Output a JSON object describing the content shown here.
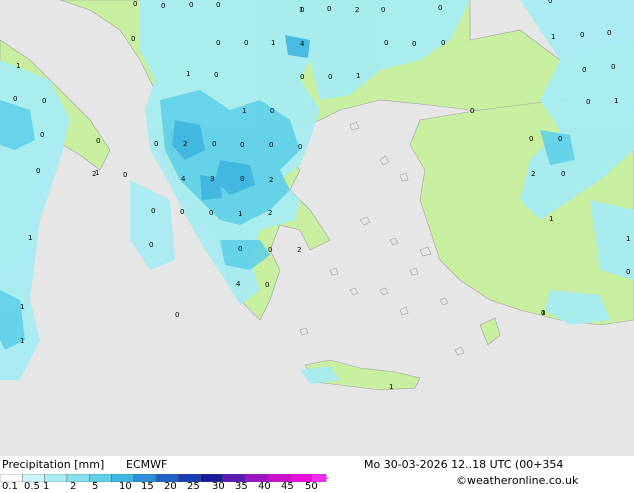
{
  "title": "Precipitation [mm]",
  "model": "ECMWF",
  "valid_time": "Mo 30-03-2026 12..18 UTC (00+354",
  "credit": "©weatheronline.co.uk",
  "legend": {
    "labels": [
      "0.1",
      "0.5",
      "1",
      "2",
      "5",
      "10",
      "15",
      "20",
      "25",
      "30",
      "35",
      "40",
      "45",
      "50"
    ],
    "colors": [
      "#ffffff",
      "#cdf4f6",
      "#a8ecf2",
      "#86e0ee",
      "#5fd0e8",
      "#3fb6e0",
      "#2a8fd6",
      "#1f62c8",
      "#1a3cb4",
      "#1c1a9c",
      "#5c1ab4",
      "#9c14c4",
      "#cc10cc",
      "#e80ee0",
      "#f02cf0"
    ]
  },
  "map_colors": {
    "sea": "#e6e6e6",
    "land_dry": "#c8f0a0",
    "light_rain": "#a8ecf2",
    "moderate_rain": "#5fd0e8",
    "heavier_rain": "#3fb6e0",
    "outline": "#a0a0a0"
  },
  "point_labels": [
    "0",
    "0",
    "0",
    "0",
    "1",
    "0",
    "2",
    "0",
    "0",
    "0",
    "0",
    "0",
    "0",
    "1",
    "4",
    "0",
    "0",
    "0",
    "1",
    "0",
    "0",
    "1",
    "1",
    "0",
    "0",
    "0",
    "1",
    "0",
    "0",
    "0",
    "0",
    "1",
    "0",
    "1",
    "0",
    "0",
    "0",
    "2",
    "0",
    "0",
    "0",
    "0",
    "0",
    "0",
    "0",
    "0",
    "0",
    "2",
    "0",
    "4",
    "3",
    "0",
    "2",
    "2",
    "0",
    "0",
    "0",
    "0",
    "1",
    "2",
    "1",
    "0",
    "0",
    "0",
    "2",
    "1",
    "4",
    "0",
    "0",
    "1",
    "0",
    "0",
    "1",
    "1",
    "1",
    "0",
    "1",
    "1"
  ]
}
